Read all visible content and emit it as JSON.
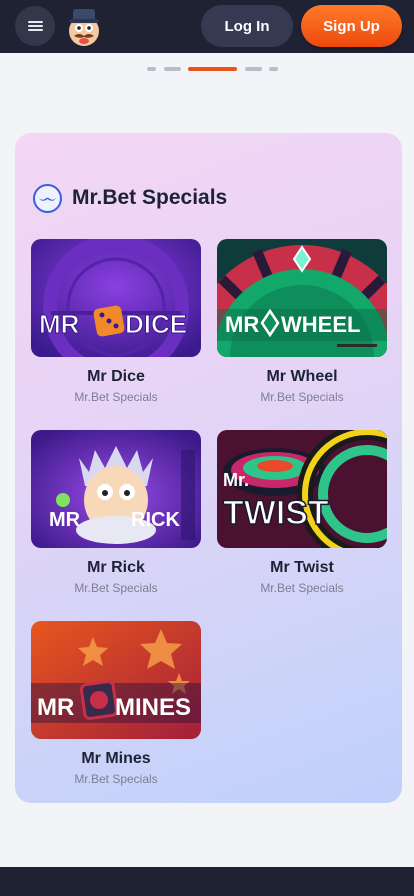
{
  "header": {
    "login_label": "Log In",
    "signup_label": "Sign Up",
    "menu_icon": "hamburger-menu-icon",
    "logo_icon": "mr-bet-mascot-logo"
  },
  "carousel": {
    "dots": 5,
    "active_index": 2
  },
  "section": {
    "title": "Mr.Bet Specials",
    "icon": "mustache-icon"
  },
  "games": [
    {
      "name": "Mr Dice",
      "category": "Mr.Bet Specials",
      "art_text": [
        "MR",
        "DICE"
      ]
    },
    {
      "name": "Mr Wheel",
      "category": "Mr.Bet Specials",
      "art_text": [
        "MR",
        "WHEEL"
      ]
    },
    {
      "name": "Mr Rick",
      "category": "Mr.Bet Specials",
      "art_text": [
        "MR",
        "RICK"
      ]
    },
    {
      "name": "Mr Twist",
      "category": "Mr.Bet Specials",
      "art_text": [
        "Mr.",
        "TWIST"
      ]
    },
    {
      "name": "Mr Mines",
      "category": "Mr.Bet Specials",
      "art_text": [
        "MR",
        "MINES"
      ]
    }
  ],
  "colors": {
    "header_bg": "#1f2233",
    "signup_orange": "#ee4a0d",
    "active_dot": "#e8531a",
    "accent_blue": "#3a5fd8"
  }
}
